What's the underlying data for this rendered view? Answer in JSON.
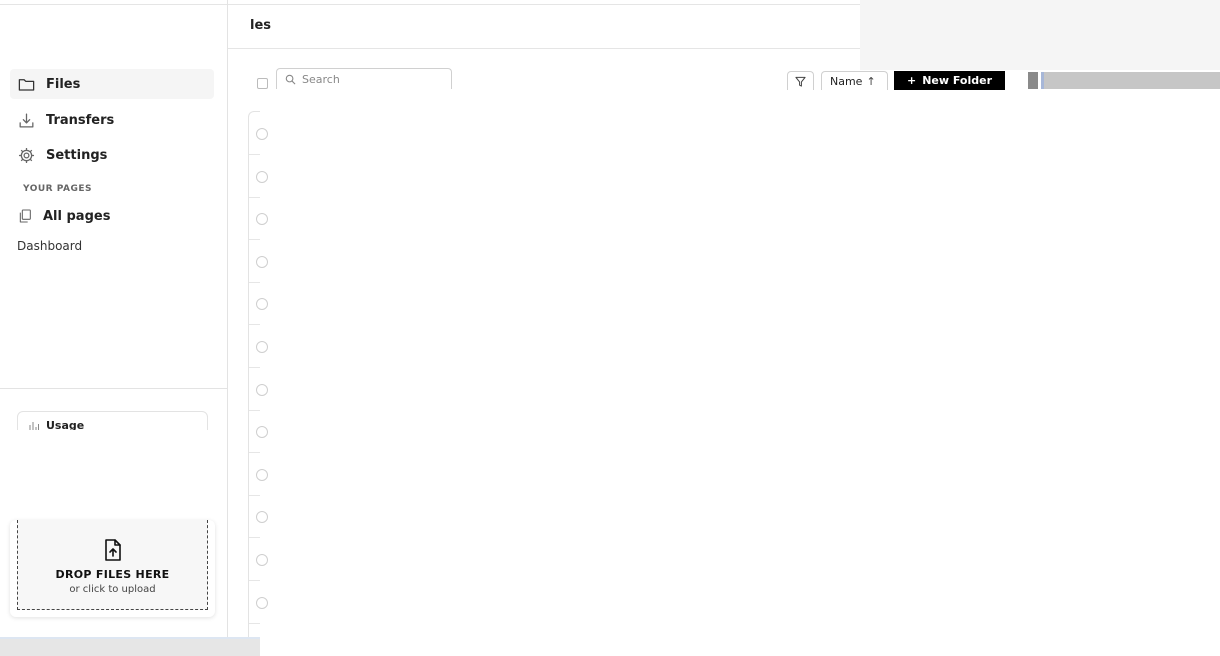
{
  "header": {
    "title": "les"
  },
  "sidebar": {
    "nav": [
      {
        "label": "Files",
        "icon": "folder-icon",
        "active": true
      },
      {
        "label": "Transfers",
        "icon": "download-tray-icon",
        "active": false
      },
      {
        "label": "Settings",
        "icon": "gear-icon",
        "active": false
      }
    ],
    "section_label": "YOUR PAGES",
    "all_pages": {
      "label": "All pages",
      "icon": "pages-copy-icon"
    },
    "sub_items": [
      "Dashboard"
    ],
    "usage": {
      "title": "Usage",
      "icon": "bar-chart-icon"
    },
    "drop": {
      "title": "DROP FILES HERE",
      "subtitle": "or click to upload",
      "icon": "file-upload-icon"
    }
  },
  "toolbar": {
    "search_placeholder": "Search",
    "sort_label": "Name",
    "sort_direction_glyph": "↑",
    "new_folder_label": "New Folder",
    "new_folder_glyph": "+"
  },
  "file_list": {
    "visible_rows": 12
  },
  "colors": {
    "primary_button": "#000000",
    "active_nav_bg": "#f5f5f5",
    "border": "#e3e3e3"
  }
}
